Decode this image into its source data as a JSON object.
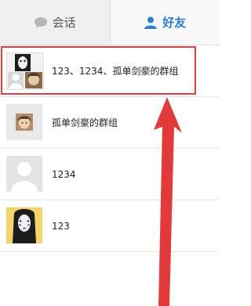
{
  "tabs": [
    {
      "label": "会话",
      "icon": "chat-bubble-icon",
      "active": false
    },
    {
      "label": "好友",
      "icon": "person-icon",
      "active": true
    }
  ],
  "friends": [
    {
      "name": "123、1234、孤单剑豪的群组",
      "avatar": "group-avatar-icon"
    },
    {
      "name": "孤单剑豪的群组",
      "avatar": "group-avatar-icon"
    },
    {
      "name": "1234",
      "avatar": "default-avatar-icon"
    },
    {
      "name": "123",
      "avatar": "user-avatar-icon"
    }
  ],
  "colors": {
    "accent": "#2e7fd0",
    "highlight": "#e23b3b"
  }
}
